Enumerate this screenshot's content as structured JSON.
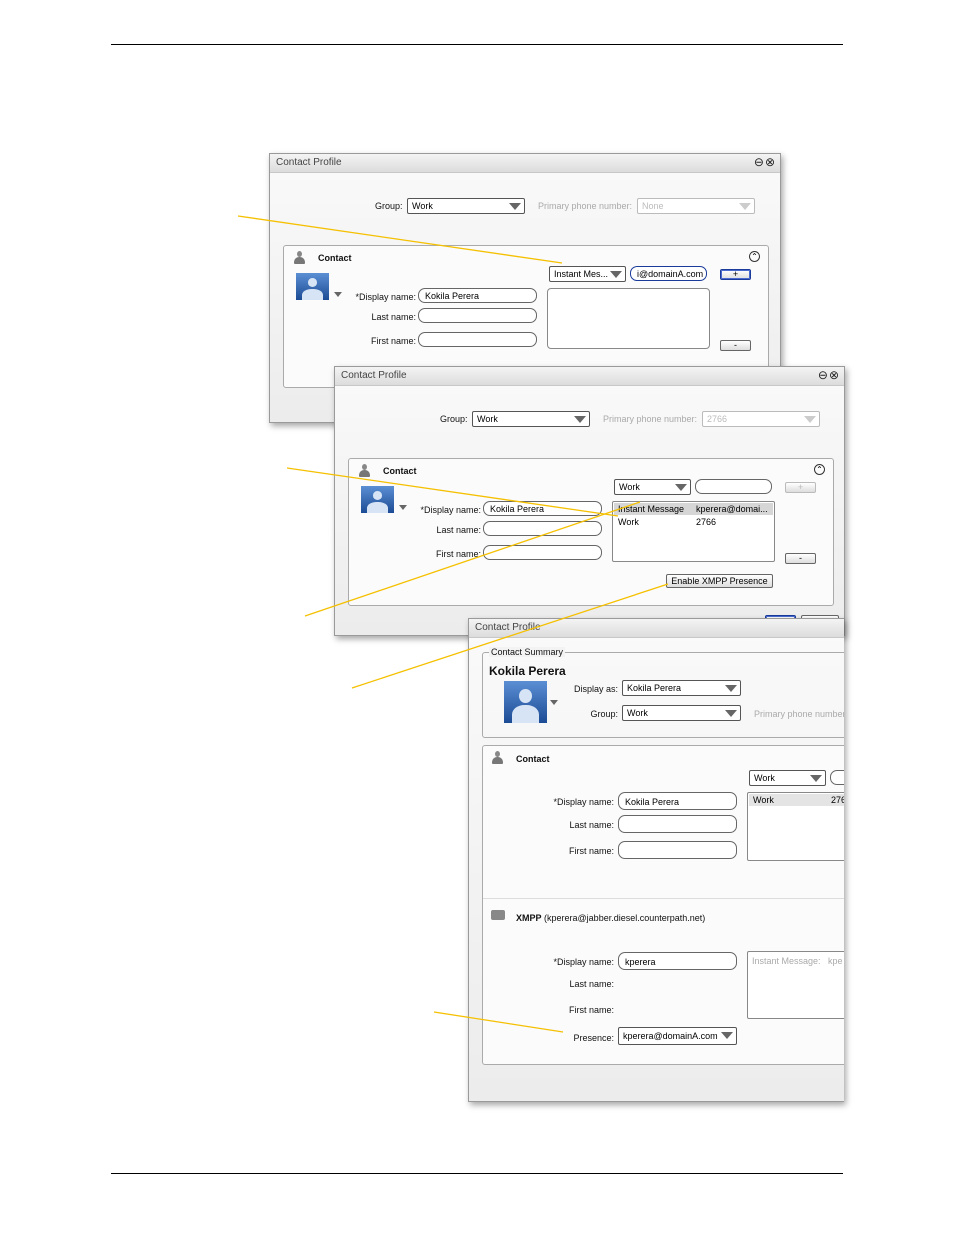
{
  "colors": {
    "callout": "#f5c000",
    "accent_blue": "#1a3b9a"
  },
  "window1": {
    "title": "Contact Profile",
    "group_label": "Group:",
    "group_value": "Work",
    "primary_phone_label": "Primary phone number:",
    "primary_phone_value": "None",
    "section_label": "Contact",
    "display_name_label": "*Display name:",
    "display_name_value": "Kokila Perera",
    "last_name_label": "Last name:",
    "first_name_label": "First name:",
    "type_select": "Instant Mes...",
    "address_value": "i@domainA.com",
    "add_button": "+",
    "remove_button": "-"
  },
  "window2": {
    "title": "Contact Profile",
    "group_label": "Group:",
    "group_value": "Work",
    "primary_phone_label": "Primary phone number:",
    "primary_phone_value": "2766",
    "section_label": "Contact",
    "display_name_label": "*Display name:",
    "display_name_value": "Kokila Perera",
    "last_name_label": "Last name:",
    "first_name_label": "First name:",
    "type_select": "Work",
    "add_button": "+",
    "remove_button": "-",
    "entries": [
      {
        "type": "Instant Message",
        "value": "kperera@domai..."
      },
      {
        "type": "Work",
        "value": "2766"
      }
    ],
    "enable_xmpp_button": "Enable XMPP Presence"
  },
  "window3": {
    "title": "Contact Profile",
    "summary_legend": "Contact Summary",
    "summary_name": "Kokila Perera",
    "display_as_label": "Display as:",
    "display_as_value": "Kokila Perera",
    "group_label": "Group:",
    "group_value": "Work",
    "primary_phone_label": "Primary phone number",
    "contact_section": "Contact",
    "display_name_label": "*Display name:",
    "display_name_value": "Kokila Perera",
    "last_name_label": "Last name:",
    "first_name_label": "First name:",
    "type_select": "Work",
    "entry_type": "Work",
    "entry_value": "276",
    "xmpp_section": "XMPP",
    "xmpp_account": "(kperera@jabber.diesel.counterpath.net)",
    "xmpp_display_name_label": "*Display name:",
    "xmpp_display_name_value": "kperera",
    "xmpp_last_name_label": "Last name:",
    "xmpp_first_name_label": "First name:",
    "presence_label": "Presence:",
    "presence_value": "kperera@domainA.com",
    "xmpp_entry_type": "Instant Message:",
    "xmpp_entry_value": "kpe"
  }
}
